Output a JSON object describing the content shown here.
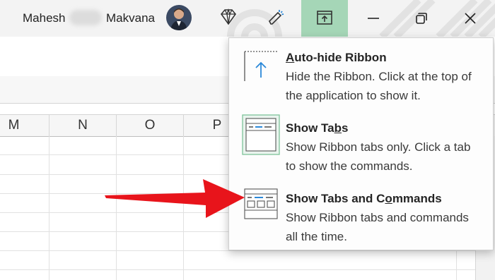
{
  "titlebar": {
    "user_first": "Mahesh",
    "user_last": "Makvana",
    "icons": [
      "avatar",
      "diamond-icon",
      "pen-sparkle-icon",
      "ribbon-display-options-icon",
      "minimize-icon",
      "restore-icon",
      "close-icon"
    ],
    "ribbon_button_color": "#a5d6b7"
  },
  "columns": [
    "M",
    "N",
    "O",
    "P"
  ],
  "menu": {
    "items": [
      {
        "title_pre": "",
        "title_key": "A",
        "title_post": "uto-hide Ribbon",
        "desc": "Hide the Ribbon. Click at the top of the application to show it.",
        "icon": "auto-hide-ribbon-icon"
      },
      {
        "title_pre": "Show Ta",
        "title_key": "b",
        "title_post": "s",
        "desc": "Show Ribbon tabs only. Click a tab to show the commands.",
        "icon": "show-tabs-icon"
      },
      {
        "title_pre": "Show Tabs and C",
        "title_key": "o",
        "title_post": "mmands",
        "desc": "Show Ribbon tabs and commands all the time.",
        "icon": "show-tabs-commands-icon"
      }
    ]
  },
  "colors": {
    "accent_blue": "#2b88d8",
    "arrow_red": "#e8141b",
    "selected_border": "#7fc49a"
  }
}
